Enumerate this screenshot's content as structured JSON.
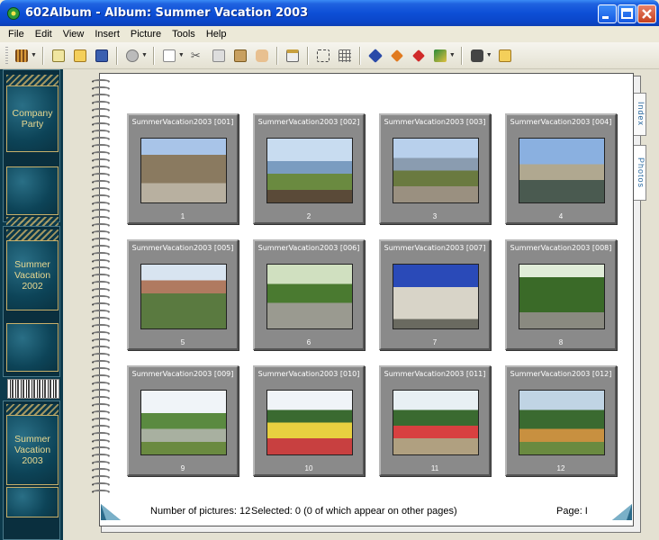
{
  "window": {
    "title": "602Album - Album: Summer Vacation 2003"
  },
  "menu": [
    {
      "label": "File",
      "key": "F"
    },
    {
      "label": "Edit",
      "key": "E"
    },
    {
      "label": "View",
      "key": "V"
    },
    {
      "label": "Insert",
      "key": "I"
    },
    {
      "label": "Picture",
      "key": "P"
    },
    {
      "label": "Tools",
      "key": "T"
    },
    {
      "label": "Help",
      "key": "H"
    }
  ],
  "albums": [
    {
      "label": "Company Party"
    },
    {
      "label": "Summer Vacation 2002"
    },
    {
      "label": "Summer Vacation 2003"
    }
  ],
  "tabs": {
    "index": "Index",
    "photos": "Photos"
  },
  "photos": [
    {
      "title": "SummerVacation2003 [001]",
      "number": "1"
    },
    {
      "title": "SummerVacation2003 [002]",
      "number": "2"
    },
    {
      "title": "SummerVacation2003 [003]",
      "number": "3"
    },
    {
      "title": "SummerVacation2003 [004]",
      "number": "4"
    },
    {
      "title": "SummerVacation2003 [005]",
      "number": "5"
    },
    {
      "title": "SummerVacation2003 [006]",
      "number": "6"
    },
    {
      "title": "SummerVacation2003 [007]",
      "number": "7"
    },
    {
      "title": "SummerVacation2003 [008]",
      "number": "8"
    },
    {
      "title": "SummerVacation2003 [009]",
      "number": "9"
    },
    {
      "title": "SummerVacation2003 [010]",
      "number": "10"
    },
    {
      "title": "SummerVacation2003 [011]",
      "number": "11"
    },
    {
      "title": "SummerVacation2003 [012]",
      "number": "12"
    }
  ],
  "status": {
    "count": "Number of pictures: 12",
    "selected": "Selected: 0 (0 of which appear on other pages)",
    "page": "Page: I"
  }
}
